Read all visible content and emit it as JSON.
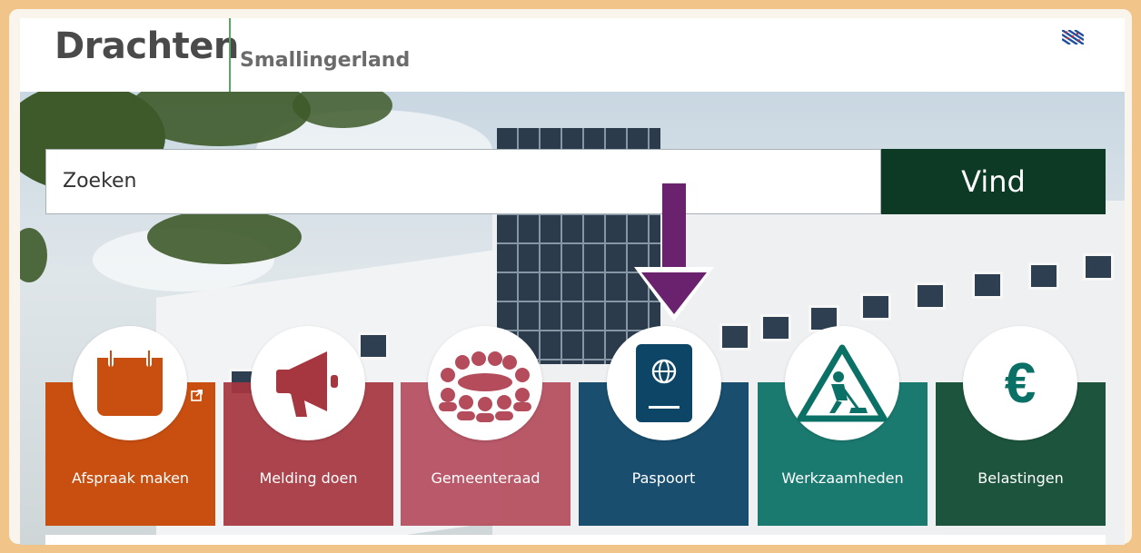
{
  "header": {
    "logo_main": "Drachten",
    "logo_sub": "Smallingerland",
    "language_flag": "frisian-flag-icon"
  },
  "search": {
    "placeholder": "Zoeken",
    "button_label": "Vind"
  },
  "tiles": [
    {
      "label": "Afspraak maken",
      "icon": "calendar-icon",
      "color": "#c94f11",
      "external": true
    },
    {
      "label": "Melding doen",
      "icon": "megaphone-icon",
      "color": "#a6363f"
    },
    {
      "label": "Gemeenteraad",
      "icon": "council-group-icon",
      "color": "#b44c5c"
    },
    {
      "label": "Paspoort",
      "icon": "passport-icon",
      "color": "#0d4566"
    },
    {
      "label": "Werkzaamheden",
      "icon": "roadwork-sign-icon",
      "color": "#0b7166"
    },
    {
      "label": "Belastingen",
      "icon": "euro-icon",
      "color": "#114b33"
    }
  ],
  "annotation": {
    "arrow_color": "#6a226e"
  }
}
